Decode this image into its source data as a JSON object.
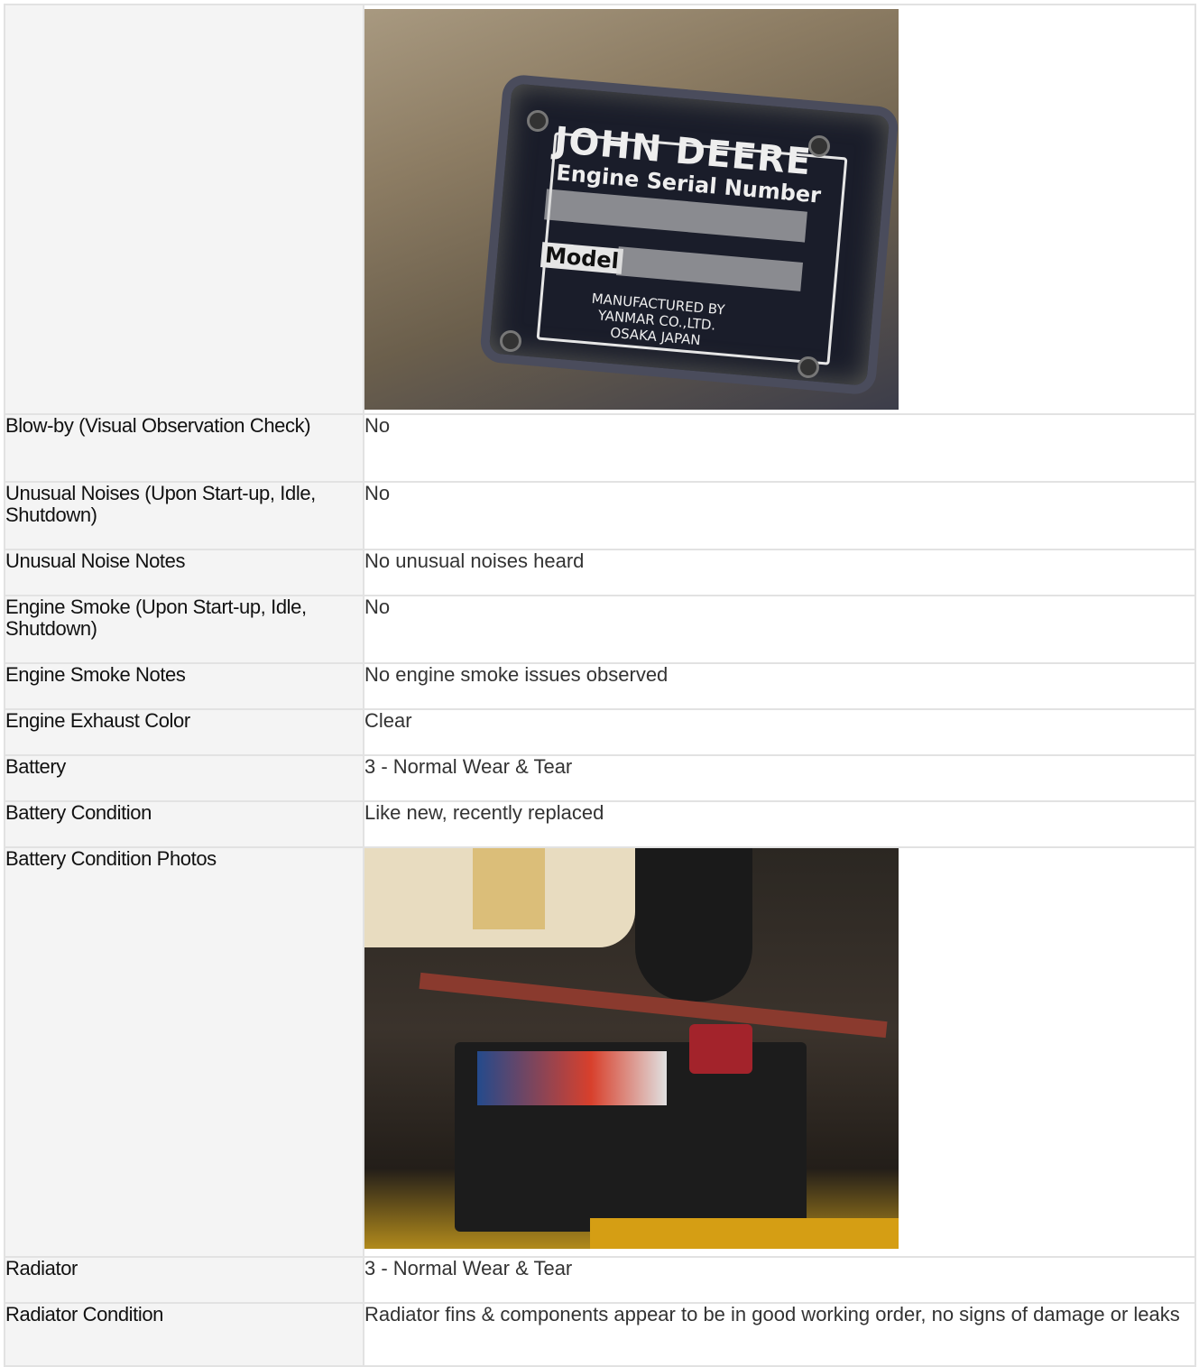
{
  "rows": [
    {
      "label": "",
      "type": "photo",
      "photo": "engine-data-plate"
    },
    {
      "label": "Blow-by (Visual Observation Check)",
      "value": "No"
    },
    {
      "label": "Unusual Noises (Upon Start-up, Idle, Shutdown)",
      "value": "No"
    },
    {
      "label": "Unusual Noise Notes",
      "value": "No unusual noises heard"
    },
    {
      "label": "Engine Smoke (Upon Start-up, Idle, Shutdown)",
      "value": "No"
    },
    {
      "label": "Engine Smoke Notes",
      "value": "No engine smoke issues observed"
    },
    {
      "label": "Engine Exhaust Color",
      "value": "Clear"
    },
    {
      "label": "Battery",
      "value": "3 - Normal Wear & Tear"
    },
    {
      "label": "Battery Condition",
      "value": "Like new, recently replaced"
    },
    {
      "label": "Battery Condition Photos",
      "type": "photo",
      "photo": "battery-photo"
    },
    {
      "label": "Radiator",
      "value": "3 - Normal Wear & Tear"
    },
    {
      "label": "Radiator Condition",
      "value": "Radiator fins & components appear to be in good working order, no signs of damage or leaks"
    }
  ],
  "photo_plate": {
    "brand": "JOHN DEERE",
    "subtitle": "Engine Serial Number",
    "model_label": "Model",
    "manufacturer_line1": "MANUFACTURED BY",
    "manufacturer_line2": "YANMAR CO.,LTD.",
    "manufacturer_line3": "OSAKA JAPAN"
  }
}
